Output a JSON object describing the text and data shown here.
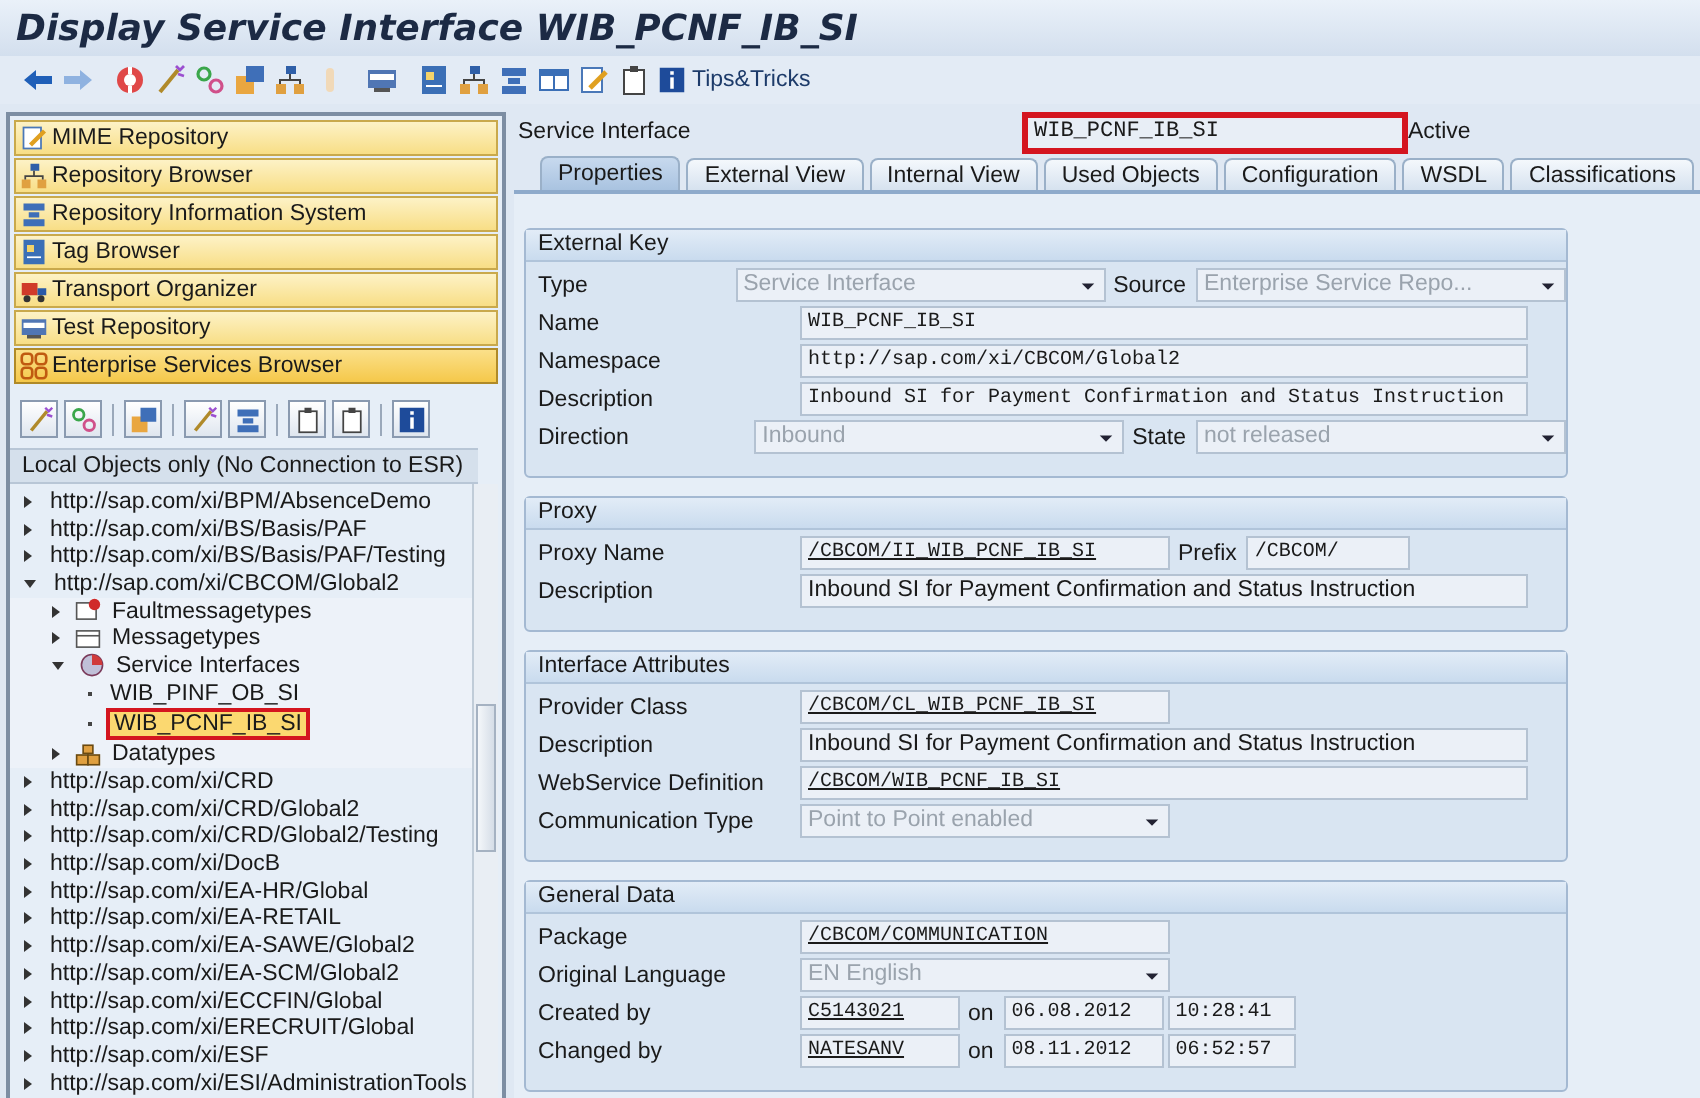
{
  "window": {
    "title": "Display Service Interface WIB_PCNF_IB_SI"
  },
  "toolbar": {
    "tips_button": "Tips&Tricks"
  },
  "navigation": [
    {
      "label": "MIME Repository",
      "kind": "mime",
      "selected": false
    },
    {
      "label": "Repository Browser",
      "kind": "browser",
      "selected": false
    },
    {
      "label": "Repository Information System",
      "kind": "infosystem",
      "selected": false
    },
    {
      "label": "Tag Browser",
      "kind": "tag",
      "selected": false
    },
    {
      "label": "Transport Organizer",
      "kind": "transport",
      "selected": false
    },
    {
      "label": "Test Repository",
      "kind": "test",
      "selected": false
    },
    {
      "label": "Enterprise Services Browser",
      "kind": "esb",
      "selected": true
    }
  ],
  "tree": {
    "header": "Local Objects only (No Connection to ESR)",
    "items": [
      {
        "label": "http://sap.com/xi/BPM/AbsenceDemo",
        "kind": "namespace",
        "expanded": false,
        "selected": false
      },
      {
        "label": "http://sap.com/xi/BS/Basis/PAF",
        "kind": "namespace",
        "expanded": false,
        "selected": false
      },
      {
        "label": "http://sap.com/xi/BS/Basis/PAF/Testing",
        "kind": "namespace",
        "expanded": false,
        "selected": false
      },
      {
        "label": "http://sap.com/xi/CBCOM/Global2",
        "kind": "namespace",
        "expanded": true,
        "selected": false,
        "children": [
          {
            "label": "Faultmessagetypes",
            "kind": "faults",
            "expanded": false,
            "selected": false
          },
          {
            "label": "Messagetypes",
            "kind": "messages",
            "expanded": false,
            "selected": false
          },
          {
            "label": "Service Interfaces",
            "kind": "interfaces",
            "expanded": true,
            "selected": false,
            "children": [
              {
                "label": "WIB_PINF_OB_SI",
                "kind": "object",
                "selected": false,
                "highlighted": false
              },
              {
                "label": "WIB_PCNF_IB_SI",
                "kind": "object",
                "selected": true,
                "highlighted": true
              }
            ]
          },
          {
            "label": "Datatypes",
            "kind": "datatypes",
            "expanded": false,
            "selected": false
          }
        ]
      },
      {
        "label": "http://sap.com/xi/CRD",
        "kind": "namespace",
        "expanded": false,
        "selected": false
      },
      {
        "label": "http://sap.com/xi/CRD/Global2",
        "kind": "namespace",
        "expanded": false,
        "selected": false
      },
      {
        "label": "http://sap.com/xi/CRD/Global2/Testing",
        "kind": "namespace",
        "expanded": false,
        "selected": false
      },
      {
        "label": "http://sap.com/xi/DocB",
        "kind": "namespace",
        "expanded": false,
        "selected": false
      },
      {
        "label": "http://sap.com/xi/EA-HR/Global",
        "kind": "namespace",
        "expanded": false,
        "selected": false
      },
      {
        "label": "http://sap.com/xi/EA-RETAIL",
        "kind": "namespace",
        "expanded": false,
        "selected": false
      },
      {
        "label": "http://sap.com/xi/EA-SAWE/Global2",
        "kind": "namespace",
        "expanded": false,
        "selected": false
      },
      {
        "label": "http://sap.com/xi/EA-SCM/Global2",
        "kind": "namespace",
        "expanded": false,
        "selected": false
      },
      {
        "label": "http://sap.com/xi/ECCFIN/Global",
        "kind": "namespace",
        "expanded": false,
        "selected": false
      },
      {
        "label": "http://sap.com/xi/ERECRUIT/Global",
        "kind": "namespace",
        "expanded": false,
        "selected": false
      },
      {
        "label": "http://sap.com/xi/ESF",
        "kind": "namespace",
        "expanded": false,
        "selected": false
      },
      {
        "label": "http://sap.com/xi/ESI/AdministrationTools",
        "kind": "namespace",
        "expanded": false,
        "selected": false
      }
    ]
  },
  "object_header": {
    "label": "Service Interface",
    "value": "WIB_PCNF_IB_SI",
    "highlighted": true,
    "status": "Active"
  },
  "tabs": [
    {
      "label": "Properties",
      "selected": true
    },
    {
      "label": "External View",
      "selected": false
    },
    {
      "label": "Internal View",
      "selected": false
    },
    {
      "label": "Used Objects",
      "selected": false
    },
    {
      "label": "Configuration",
      "selected": false
    },
    {
      "label": "WSDL",
      "selected": false
    },
    {
      "label": "Classifications",
      "selected": false
    }
  ],
  "groups": [
    {
      "title": "External Key",
      "rows": [
        {
          "label": "Type",
          "items": [
            {
              "kind": "dropdown",
              "value": "Service Interface",
              "disabled": true
            },
            {
              "kind": "label",
              "value": "Source"
            },
            {
              "kind": "dropdown",
              "value": "Enterprise Service Repo...",
              "disabled": true
            }
          ]
        },
        {
          "label": "Name",
          "items": [
            {
              "kind": "code",
              "value": "WIB_PCNF_IB_SI",
              "underlined": false,
              "wide": true
            }
          ]
        },
        {
          "label": "Namespace",
          "items": [
            {
              "kind": "code",
              "value": "http://sap.com/xi/CBCOM/Global2",
              "underlined": false,
              "wide": true
            }
          ]
        },
        {
          "label": "Description",
          "items": [
            {
              "kind": "code",
              "value": "Inbound SI for Payment Confirmation and Status Instruction",
              "underlined": false,
              "wide": true
            }
          ]
        },
        {
          "label": "Direction",
          "items": [
            {
              "kind": "dropdown",
              "value": "Inbound",
              "disabled": true
            },
            {
              "kind": "label",
              "value": "State"
            },
            {
              "kind": "dropdown",
              "value": "not released",
              "disabled": true
            }
          ]
        }
      ]
    },
    {
      "title": "Proxy",
      "rows": [
        {
          "label": "Proxy Name",
          "items": [
            {
              "kind": "code",
              "value": "/CBCOM/II_WIB_PCNF_IB_SI",
              "underlined": true,
              "wide": false
            },
            {
              "kind": "label",
              "value": "Prefix"
            },
            {
              "kind": "code",
              "value": "/CBCOM/",
              "underlined": false,
              "wide": false
            }
          ]
        },
        {
          "label": "Description",
          "items": [
            {
              "kind": "text",
              "value": "Inbound SI for Payment Confirmation and Status Instruction",
              "wide": true
            }
          ]
        }
      ]
    },
    {
      "title": "Interface Attributes",
      "rows": [
        {
          "label": "Provider Class",
          "items": [
            {
              "kind": "code",
              "value": "/CBCOM/CL_WIB_PCNF_IB_SI",
              "underlined": true,
              "wide": false
            }
          ]
        },
        {
          "label": "Description",
          "items": [
            {
              "kind": "text",
              "value": "Inbound SI for Payment Confirmation and Status Instruction",
              "wide": true
            }
          ]
        },
        {
          "label": "WebService Definition",
          "items": [
            {
              "kind": "code",
              "value": "/CBCOM/WIB_PCNF_IB_SI",
              "underlined": true,
              "wide": true
            }
          ]
        },
        {
          "label": "Communication Type",
          "items": [
            {
              "kind": "dropdown",
              "value": "Point to Point enabled",
              "disabled": true
            }
          ]
        }
      ]
    },
    {
      "title": "General Data",
      "rows": [
        {
          "label": "Package",
          "items": [
            {
              "kind": "code",
              "value": "/CBCOM/COMMUNICATION",
              "underlined": true,
              "wide": false
            }
          ]
        },
        {
          "label": "Original Language",
          "items": [
            {
              "kind": "dropdown",
              "value": "EN English",
              "disabled": true
            }
          ]
        },
        {
          "label": "Created by",
          "items": [
            {
              "kind": "user",
              "value": "C5143021",
              "underlined": true
            },
            {
              "kind": "label",
              "value": "on"
            },
            {
              "kind": "date",
              "value": "06.08.2012"
            },
            {
              "kind": "time",
              "value": "10:28:41"
            }
          ]
        },
        {
          "label": "Changed by",
          "items": [
            {
              "kind": "user",
              "value": "NATESANV",
              "underlined": true
            },
            {
              "kind": "label",
              "value": "on"
            },
            {
              "kind": "date",
              "value": "08.11.2012"
            },
            {
              "kind": "time",
              "value": "06:52:57"
            }
          ]
        }
      ]
    }
  ]
}
